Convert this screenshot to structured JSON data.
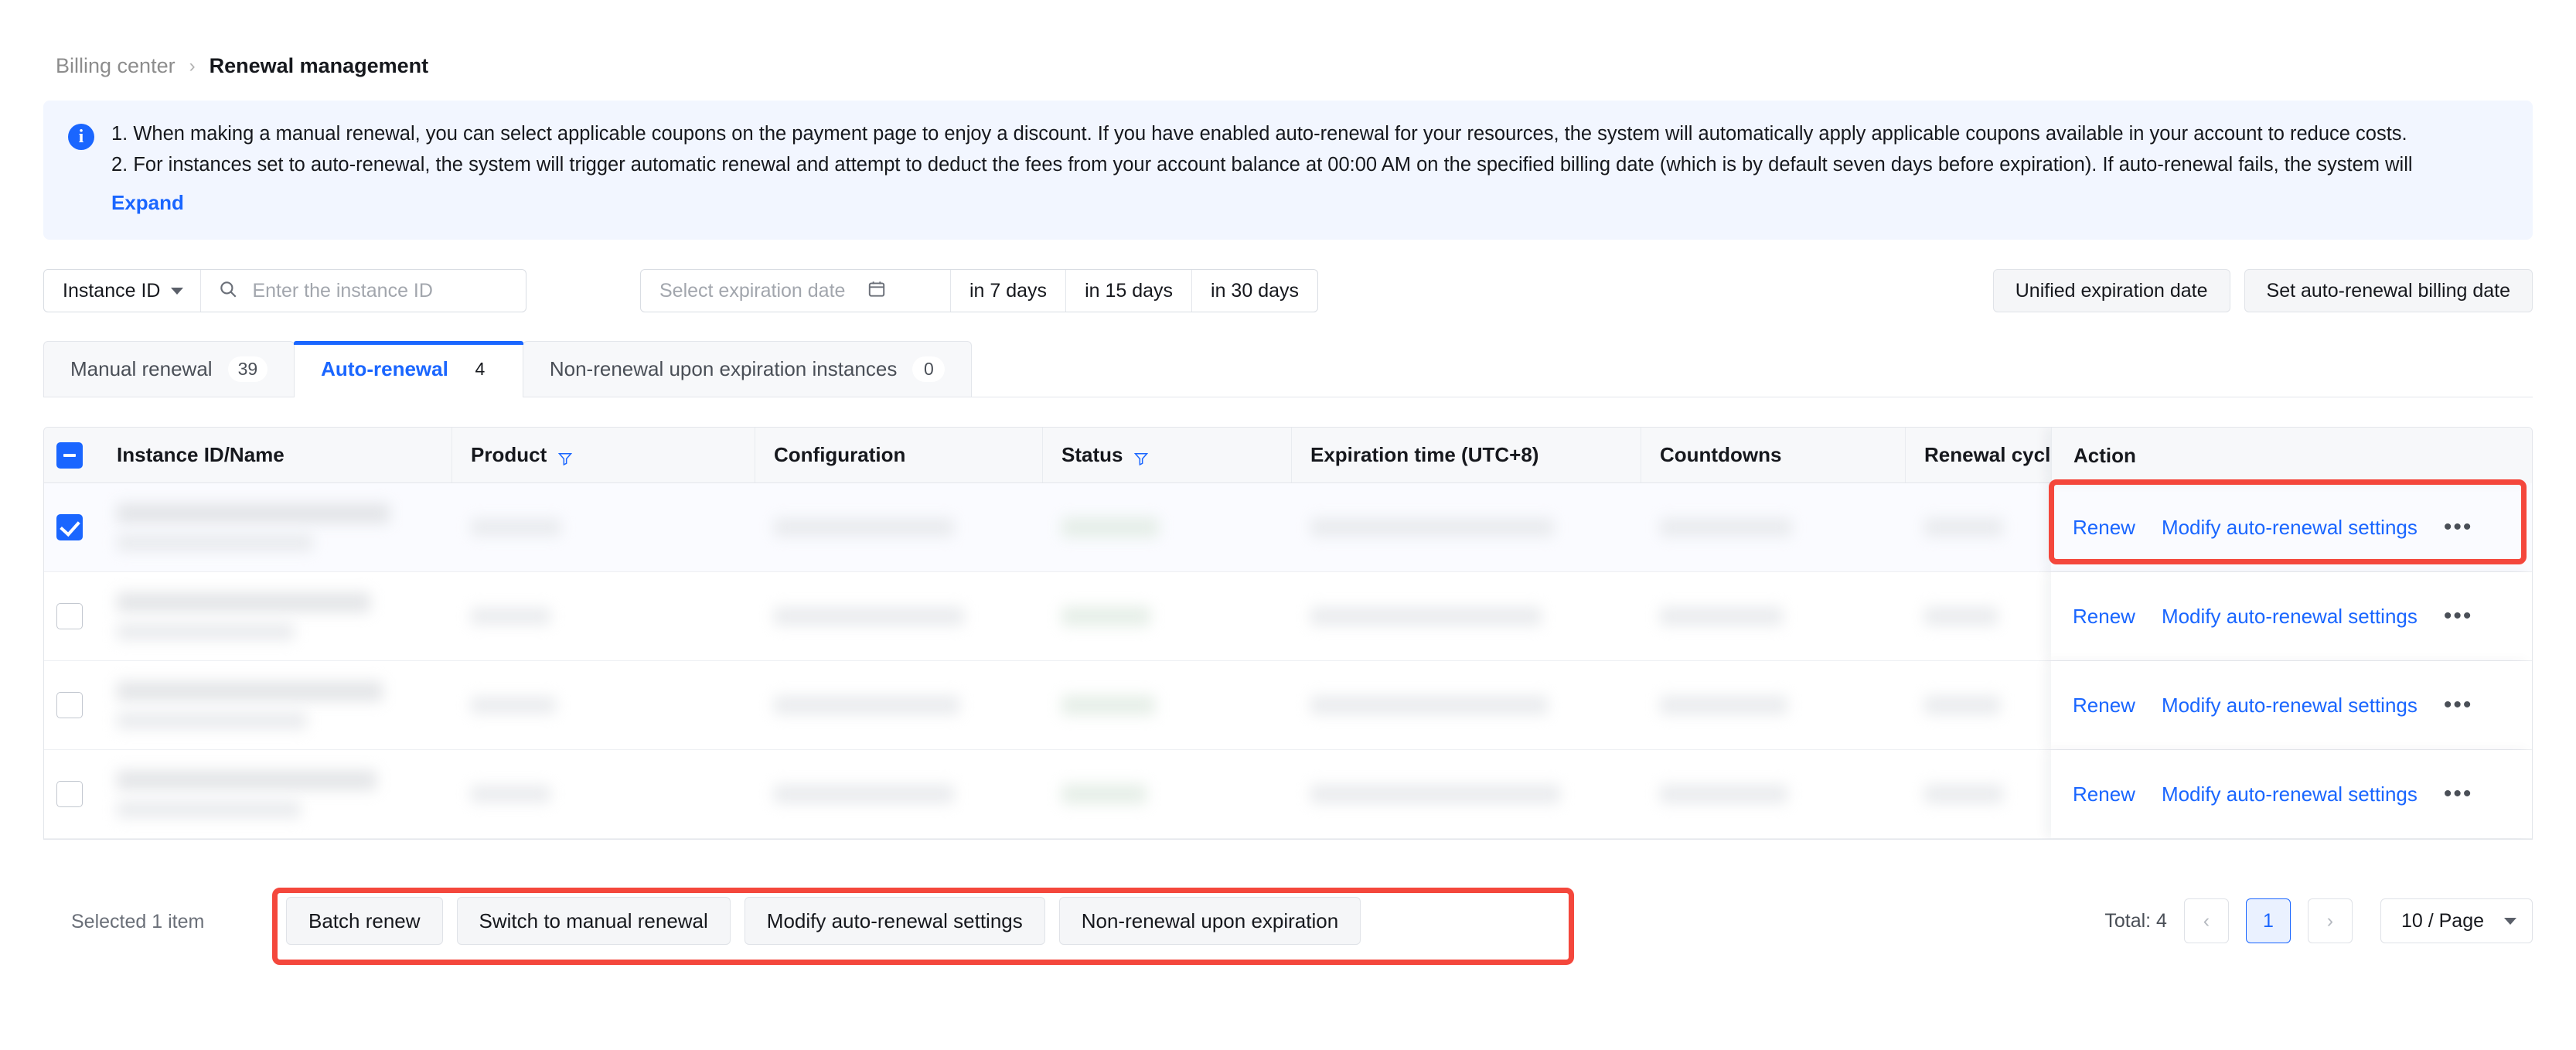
{
  "breadcrumb": {
    "parent": "Billing center",
    "separator": "›",
    "current": "Renewal management"
  },
  "banner": {
    "icon": "info-icon",
    "line1": "1. When making a manual renewal, you can select applicable coupons on the payment page to enjoy a discount. If you have enabled auto-renewal for your resources, the system will automatically apply applicable coupons available in your account to reduce costs.",
    "line2": "2. For instances set to auto-renewal, the system will trigger automatic renewal and attempt to deduct the fees from your account balance at 00:00 AM on the specified billing date (which is by default seven days before expiration). If auto-renewal fails, the system will",
    "expand_label": "Expand"
  },
  "toolbar": {
    "filter_select": "Instance ID",
    "search_placeholder": "Enter the instance ID",
    "search_value": "",
    "search_icon": "search-icon",
    "date_placeholder": "Select expiration date",
    "calendar_icon": "calendar-icon",
    "chips": [
      "in 7 days",
      "in 15 days",
      "in 30 days"
    ],
    "unified_expiration_date": "Unified expiration date",
    "set_auto_renewal_billing_date": "Set auto-renewal billing date"
  },
  "tabs": [
    {
      "label": "Manual renewal",
      "count": "39",
      "active": false
    },
    {
      "label": "Auto-renewal",
      "count": "4",
      "active": true
    },
    {
      "label": "Non-renewal upon expiration instances",
      "count": "0",
      "active": false
    }
  ],
  "table": {
    "select_all_state": "indeterminate",
    "columns": [
      {
        "key": "check",
        "label": ""
      },
      {
        "key": "name",
        "label": "Instance ID/Name"
      },
      {
        "key": "product",
        "label": "Product",
        "filterable": true
      },
      {
        "key": "configuration",
        "label": "Configuration"
      },
      {
        "key": "status",
        "label": "Status",
        "filterable": true
      },
      {
        "key": "expiration",
        "label": "Expiration time (UTC+8)"
      },
      {
        "key": "countdowns",
        "label": "Countdowns"
      },
      {
        "key": "cycle",
        "label": "Renewal cycl"
      },
      {
        "key": "action",
        "label": "Action"
      }
    ],
    "rows": [
      {
        "selected": true,
        "actions": [
          "Renew",
          "Modify auto-renewal settings"
        ],
        "more_icon": "ellipsis-icon"
      },
      {
        "selected": false,
        "actions": [
          "Renew",
          "Modify auto-renewal settings"
        ],
        "more_icon": "ellipsis-icon"
      },
      {
        "selected": false,
        "actions": [
          "Renew",
          "Modify auto-renewal settings"
        ],
        "more_icon": "ellipsis-icon"
      },
      {
        "selected": false,
        "actions": [
          "Renew",
          "Modify auto-renewal settings"
        ],
        "more_icon": "ellipsis-icon"
      }
    ]
  },
  "footer": {
    "selected_text": "Selected 1 item",
    "batch_buttons": [
      "Batch renew",
      "Switch to manual renewal",
      "Modify auto-renewal settings",
      "Non-renewal upon expiration"
    ],
    "total": "Total: 4",
    "prev_icon": "chevron-left-icon",
    "next_icon": "chevron-right-icon",
    "current_page": "1",
    "page_size": "10 / Page",
    "page_size_caret": "chevron-down-icon"
  },
  "colors": {
    "accent": "#1a66ff",
    "annotation": "#f4473c",
    "banner_bg": "#f2f6ff",
    "header_bg": "#f7f8fa"
  }
}
